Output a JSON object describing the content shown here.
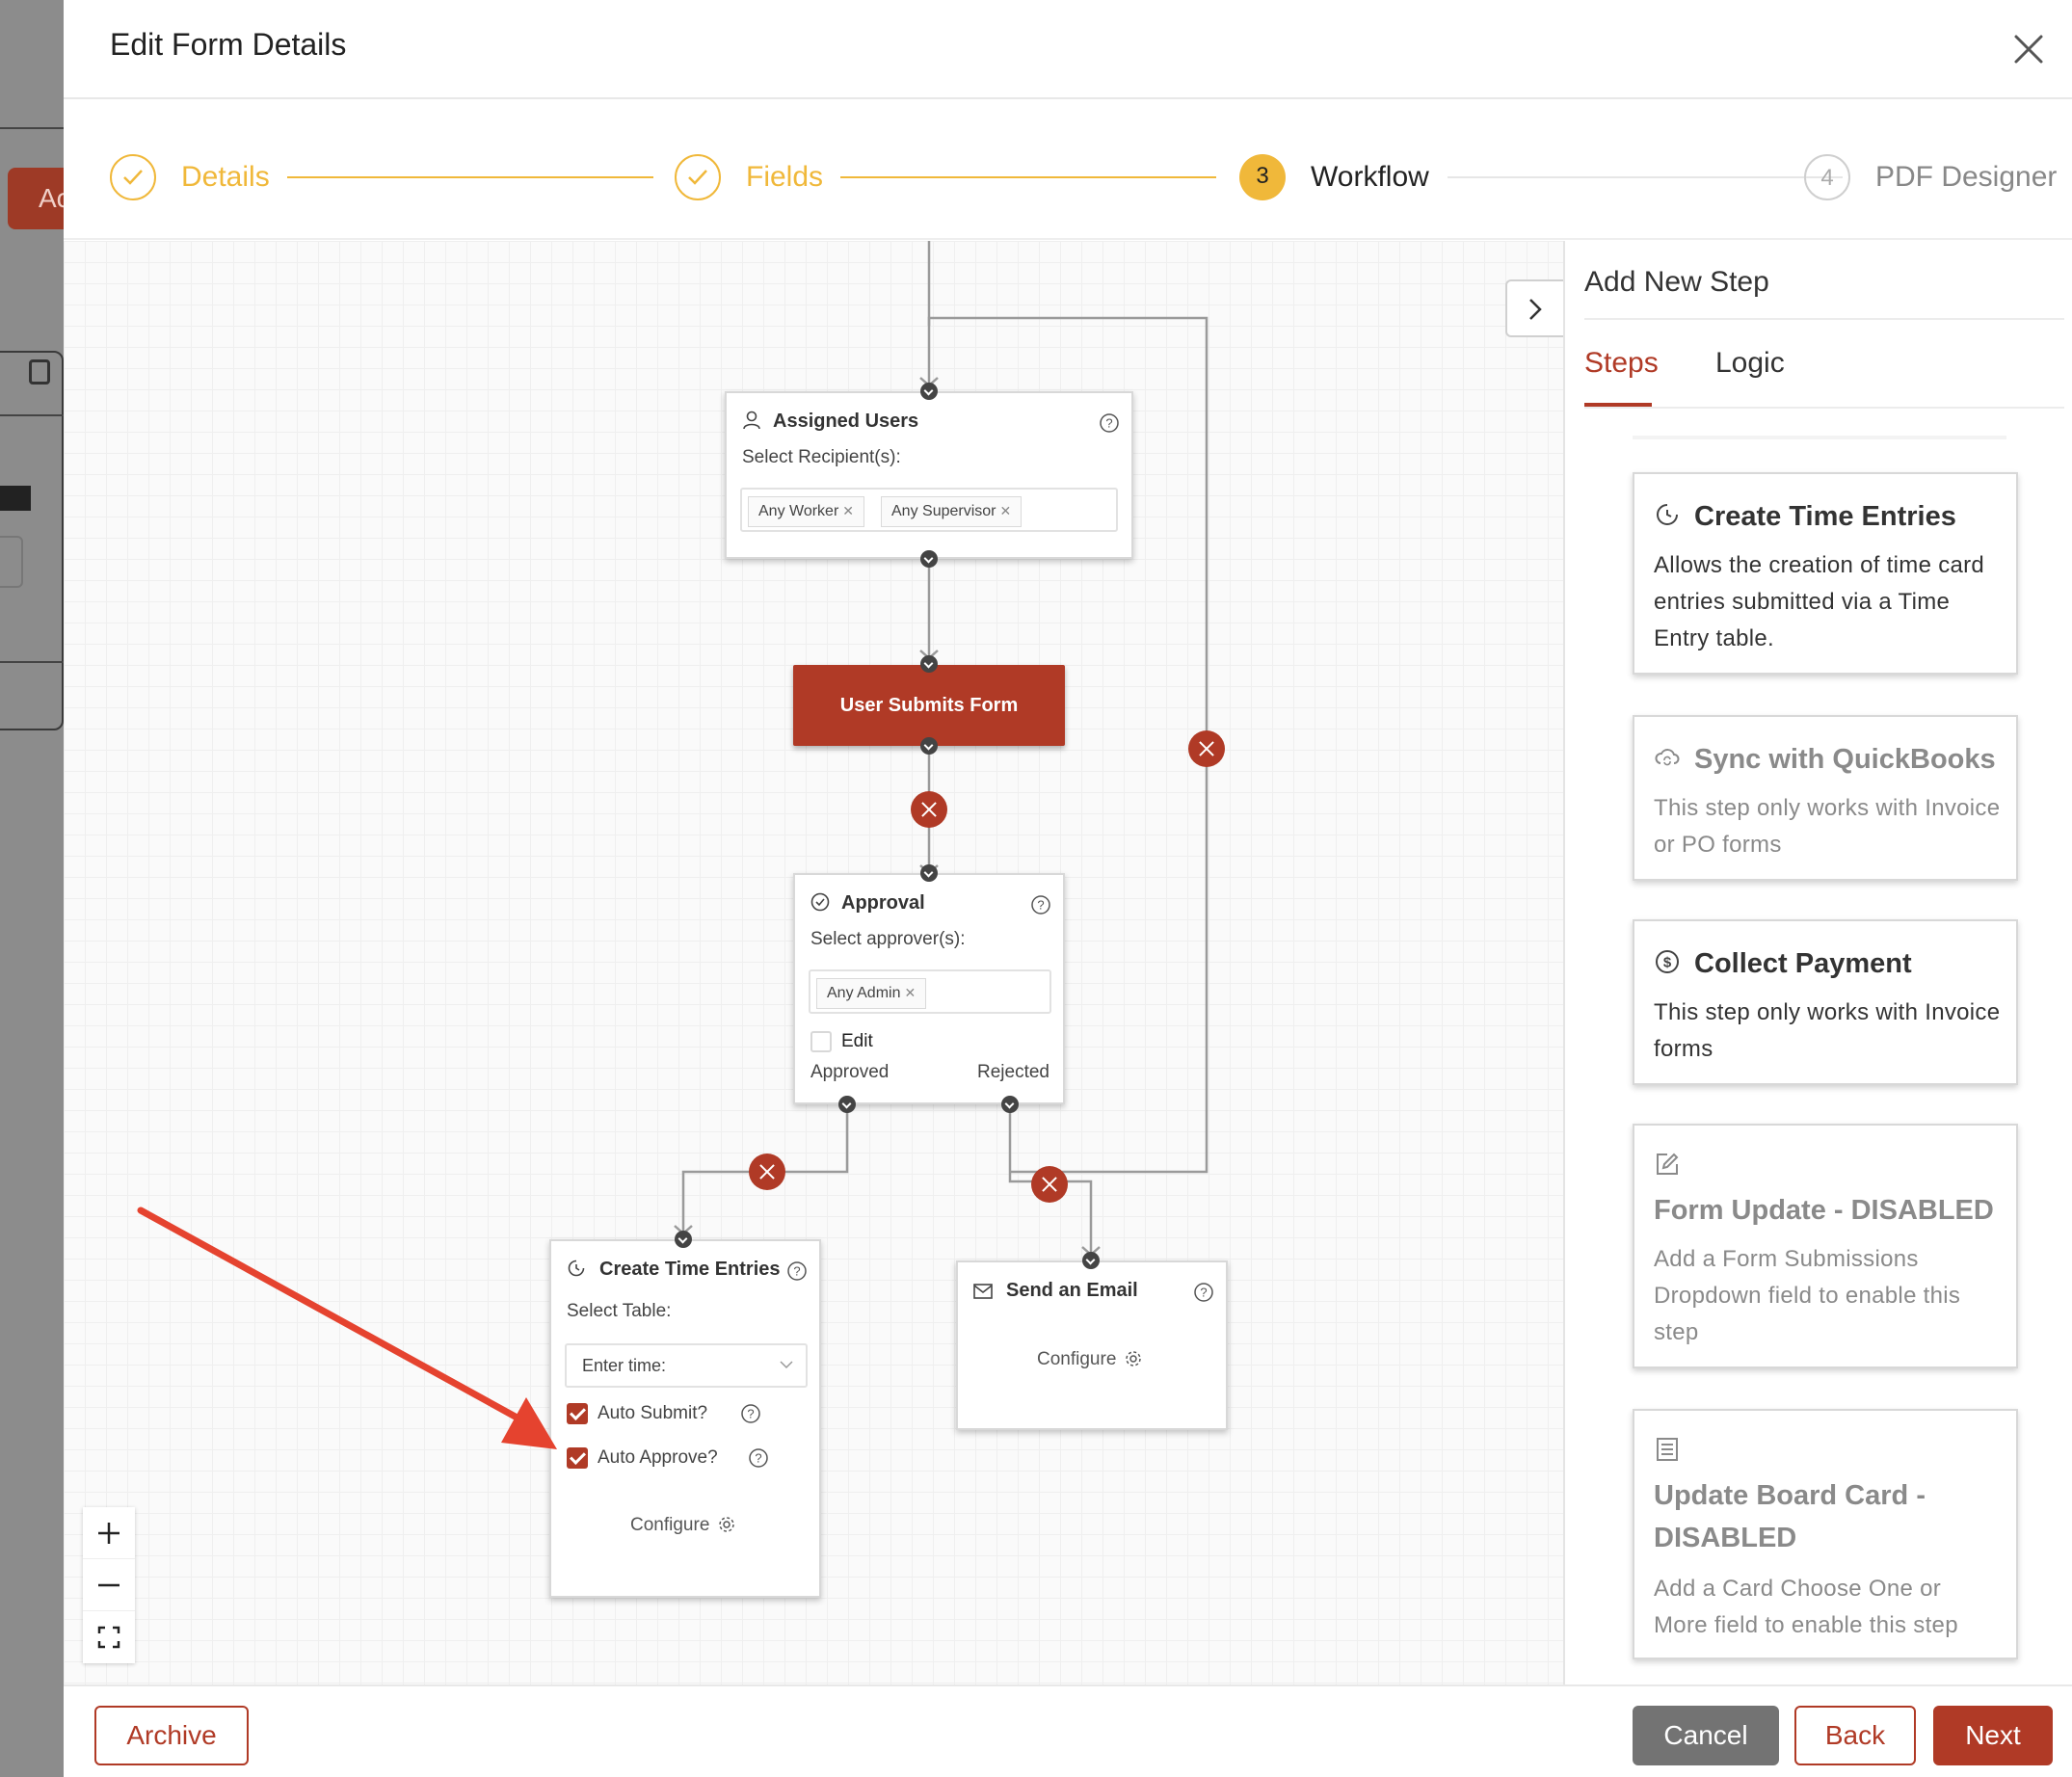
{
  "background": {
    "button_partial": "Ac"
  },
  "modal": {
    "title": "Edit Form Details"
  },
  "stepper": {
    "steps": [
      {
        "label": "Details",
        "number": "",
        "state": "done"
      },
      {
        "label": "Fields",
        "number": "",
        "state": "done"
      },
      {
        "label": "Workflow",
        "number": "3",
        "state": "active"
      },
      {
        "label": "PDF Designer",
        "number": "4",
        "state": "todo"
      }
    ]
  },
  "workflow": {
    "assigned_users": {
      "title": "Assigned Users",
      "label": "Select Recipient(s):",
      "tags": [
        "Any Worker",
        "Any Supervisor"
      ]
    },
    "submit_node": {
      "label": "User Submits Form"
    },
    "approval": {
      "title": "Approval",
      "label": "Select approver(s):",
      "tags": [
        "Any Admin"
      ],
      "edit_label": "Edit",
      "approved_label": "Approved",
      "rejected_label": "Rejected"
    },
    "create_time_entries": {
      "title": "Create Time Entries",
      "label": "Select Table:",
      "select_placeholder": "Enter time:",
      "auto_submit_label": "Auto Submit?",
      "auto_approve_label": "Auto Approve?",
      "configure_label": "Configure"
    },
    "send_email": {
      "title": "Send an Email",
      "configure_label": "Configure"
    }
  },
  "side_panel": {
    "title": "Add New Step",
    "tabs": [
      "Steps",
      "Logic"
    ],
    "active_tab": "Steps",
    "cards": [
      {
        "title": "Create Time Entries",
        "description": "Allows the creation of time card entries submitted via a Time Entry table.",
        "icon": "clock-icon",
        "disabled": false
      },
      {
        "title": "Sync with QuickBooks",
        "description": "This step only works with Invoice or PO forms",
        "icon": "cloud-sync-icon",
        "disabled": true
      },
      {
        "title": "Collect Payment",
        "description": "This step only works with Invoice forms",
        "icon": "dollar-icon",
        "disabled": false
      },
      {
        "title": "Form Update - DISABLED",
        "description": "Add a Form Submissions Dropdown field to enable this step",
        "icon": "edit-icon",
        "disabled": true
      },
      {
        "title": "Update Board Card - DISABLED",
        "description": "Add a Card Choose One or More field to enable this step",
        "icon": "board-icon",
        "disabled": true
      }
    ]
  },
  "footer": {
    "archive_label": "Archive",
    "cancel_label": "Cancel",
    "back_label": "Back",
    "next_label": "Next"
  },
  "colors": {
    "accent": "#b03a26",
    "step_done": "#f0b83a",
    "annotation_arrow": "#e5432f"
  }
}
